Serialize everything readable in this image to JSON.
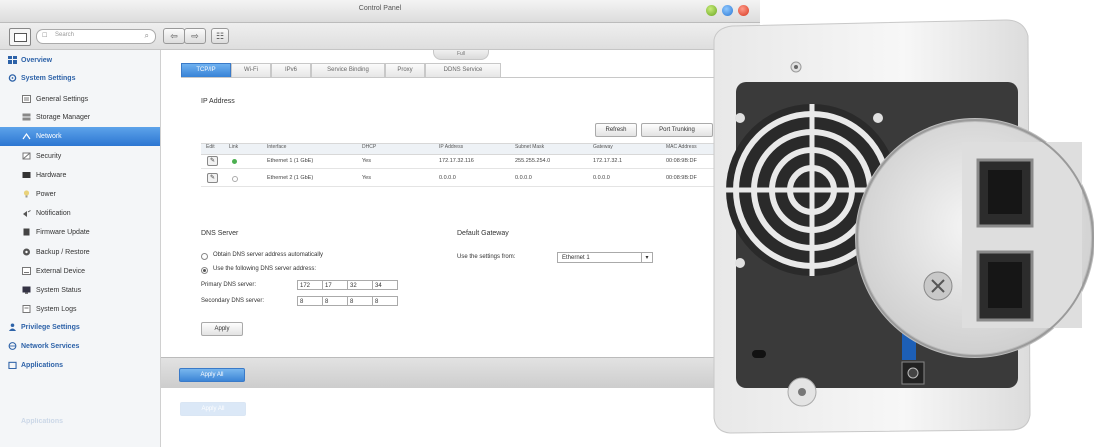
{
  "window": {
    "title": "Control Panel"
  },
  "toolbar": {
    "search_placeholder": "Search",
    "back": "⇦",
    "forward": "⇨",
    "grid": "☷"
  },
  "sidebar": {
    "overview": "Overview",
    "system_settings": "System Settings",
    "items": [
      "General Settings",
      "Storage Manager",
      "Network",
      "Security",
      "Hardware",
      "Power",
      "Notification",
      "Firmware Update",
      "Backup / Restore",
      "External Device",
      "System Status",
      "System Logs"
    ],
    "privilege": "Privilege Settings",
    "network_services": "Network Services",
    "applications": "Applications",
    "reflection": "Applications"
  },
  "tabs": [
    "TCP/IP",
    "Wi-Fi",
    "IPv6",
    "Service Binding",
    "Proxy",
    "DDNS Service"
  ],
  "top_flap": "Full",
  "ip_address": {
    "title": "IP Address",
    "refresh_button": "Refresh",
    "port_trunking_button": "Port Trunking",
    "columns": [
      "Edit",
      "Link",
      "Interface",
      "DHCP",
      "IP Address",
      "Subnet Mask",
      "Gateway",
      "MAC Address"
    ],
    "rows": [
      {
        "interface": "Ethernet 1 (1 GbE)",
        "dhcp": "Yes",
        "ip": "172.17.32.116",
        "mask": "255.255.254.0",
        "gateway": "172.17.32.1",
        "mac": "00:08:9B:DF",
        "link_color": "#4caf50"
      },
      {
        "interface": "Ethernet 2 (1 GbE)",
        "dhcp": "Yes",
        "ip": "0.0.0.0",
        "mask": "0.0.0.0",
        "gateway": "0.0.0.0",
        "mac": "00:08:9B:DF",
        "link_color": "#bfbfbf"
      }
    ]
  },
  "dns": {
    "title": "DNS Server",
    "option_auto": "Obtain DNS server address automatically",
    "option_manual": "Use the following DNS server address:",
    "primary_label": "Primary DNS server:",
    "secondary_label": "Secondary DNS server:",
    "primary": [
      "172",
      "17",
      "32",
      "34"
    ],
    "secondary": [
      "8",
      "8",
      "8",
      "8"
    ],
    "apply_button": "Apply"
  },
  "gateway": {
    "title": "Default Gateway",
    "use_label": "Use the settings from:",
    "selected": "Ethernet 1"
  },
  "bottom": {
    "apply_all": "Apply All",
    "reflection": "Apply All"
  }
}
